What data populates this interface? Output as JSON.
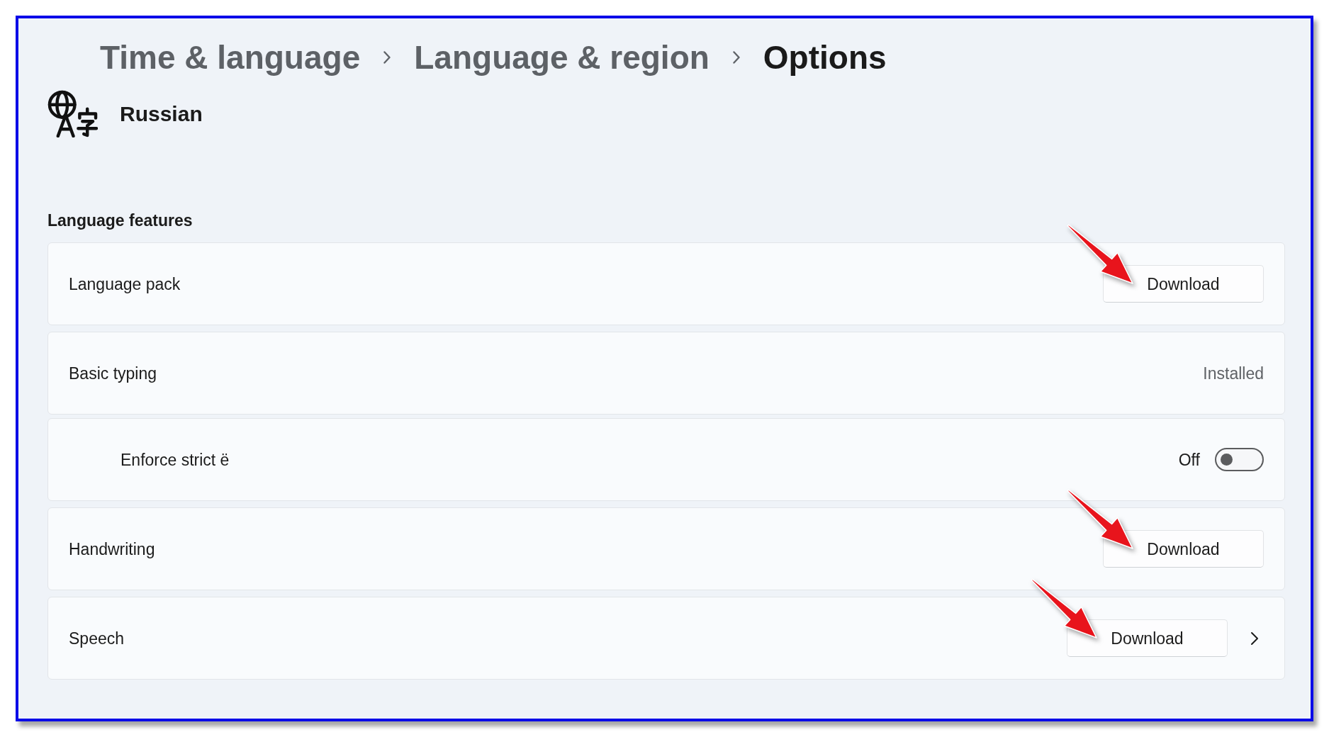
{
  "breadcrumb": [
    {
      "label": "Time & language",
      "current": false
    },
    {
      "label": "Language & region",
      "current": false
    },
    {
      "label": "Options",
      "current": true
    }
  ],
  "language": {
    "name": "Russian"
  },
  "section": {
    "title": "Language features"
  },
  "features": [
    {
      "kind": "action",
      "label": "Language pack",
      "action": "Download"
    },
    {
      "kind": "status",
      "label": "Basic typing",
      "status": "Installed",
      "children": [
        {
          "kind": "toggle",
          "label": "Enforce strict ë",
          "state_label": "Off",
          "on": false
        }
      ]
    },
    {
      "kind": "action",
      "label": "Handwriting",
      "action": "Download"
    },
    {
      "kind": "action-link",
      "label": "Speech",
      "action": "Download"
    }
  ]
}
